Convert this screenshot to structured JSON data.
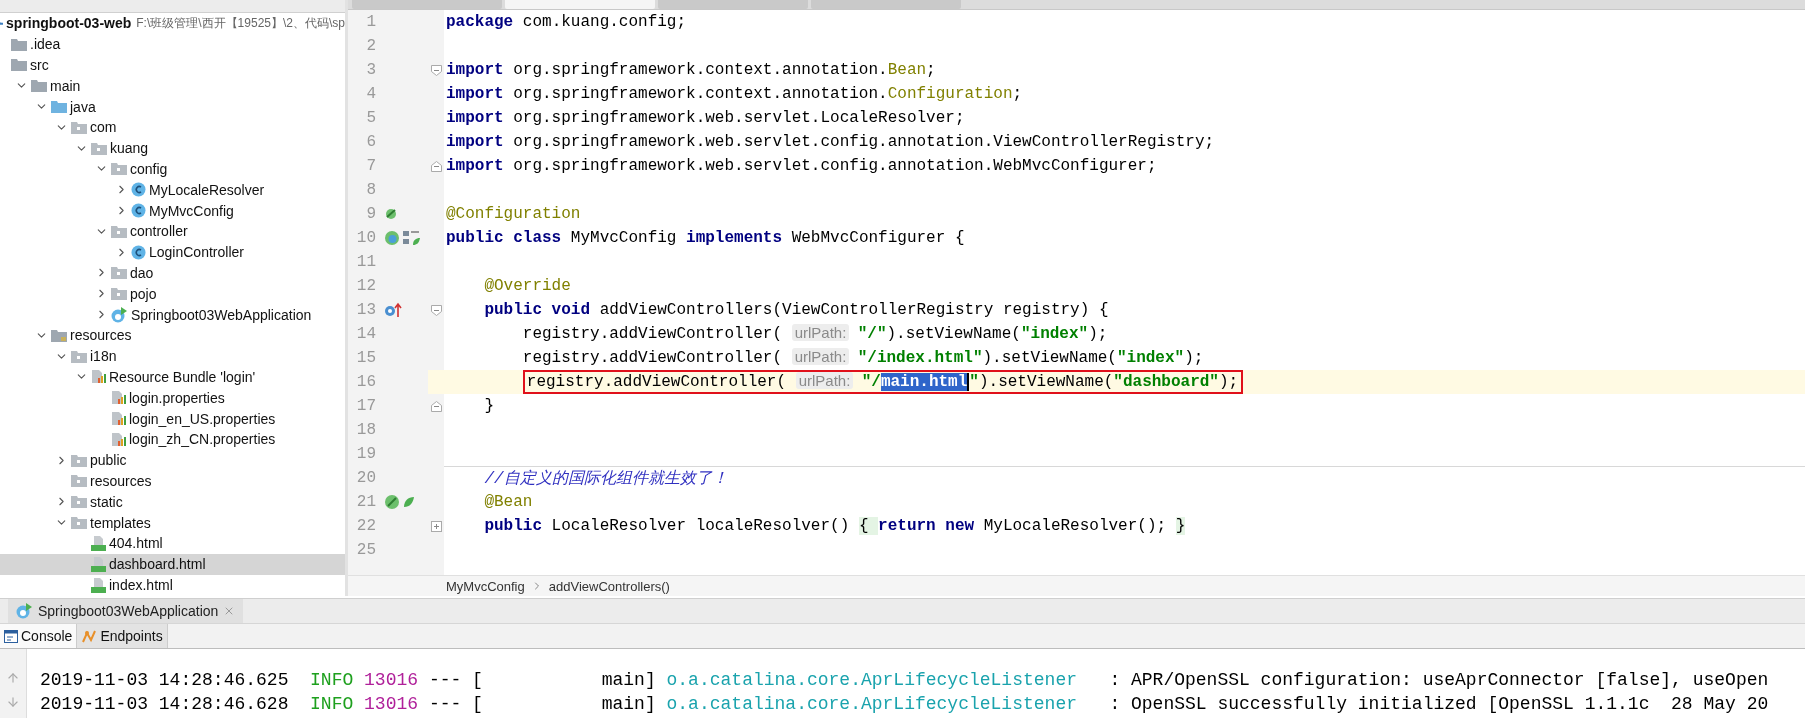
{
  "editor_tabs": [
    {
      "selected": false
    },
    {
      "selected": true
    },
    {
      "selected": false
    },
    {
      "selected": false
    }
  ],
  "project_tree": [
    {
      "label": "springboot-03-web",
      "path": "F:\\班级管理\\西开【19525】\\2、代码\\sp",
      "kind": "module",
      "selected": false,
      "children": [
        {
          "label": ".idea",
          "kind": "folder",
          "selected": false
        },
        {
          "label": "src",
          "kind": "folder",
          "selected": false,
          "children": [
            {
              "label": "main",
              "kind": "folder",
              "expanded": true,
              "selected": false,
              "children": [
                {
                  "label": "java",
                  "kind": "source",
                  "expanded": true,
                  "selected": false,
                  "children": [
                    {
                      "label": "com",
                      "kind": "package",
                      "expanded": true,
                      "selected": false,
                      "children": [
                        {
                          "label": "kuang",
                          "kind": "package",
                          "expanded": true,
                          "selected": false,
                          "children": [
                            {
                              "label": "config",
                              "kind": "package",
                              "expanded": true,
                              "selected": false,
                              "children": [
                                {
                                  "label": "MyLocaleResolver",
                                  "kind": "class",
                                  "expanded": false,
                                  "selected": false
                                },
                                {
                                  "label": "MyMvcConfig",
                                  "kind": "class",
                                  "expanded": false,
                                  "selected": false
                                }
                              ]
                            },
                            {
                              "label": "controller",
                              "kind": "package",
                              "expanded": true,
                              "selected": false,
                              "children": [
                                {
                                  "label": "LoginController",
                                  "kind": "class",
                                  "expanded": false,
                                  "selected": false
                                }
                              ]
                            },
                            {
                              "label": "dao",
                              "kind": "package",
                              "expanded": false,
                              "selected": false
                            },
                            {
                              "label": "pojo",
                              "kind": "package",
                              "expanded": false,
                              "selected": false
                            },
                            {
                              "label": "Springboot03WebApplication",
                              "kind": "app",
                              "expanded": false,
                              "selected": false
                            }
                          ]
                        }
                      ]
                    }
                  ]
                },
                {
                  "label": "resources",
                  "kind": "resources",
                  "expanded": true,
                  "selected": false,
                  "children": [
                    {
                      "label": "i18n",
                      "kind": "package",
                      "expanded": true,
                      "selected": false,
                      "children": [
                        {
                          "label": "Resource Bundle 'login'",
                          "kind": "bundle",
                          "expanded": true,
                          "selected": false,
                          "children": [
                            {
                              "label": "login.properties",
                              "kind": "properties",
                              "selected": false
                            },
                            {
                              "label": "login_en_US.properties",
                              "kind": "properties",
                              "selected": false
                            },
                            {
                              "label": "login_zh_CN.properties",
                              "kind": "properties",
                              "selected": false
                            }
                          ]
                        }
                      ]
                    },
                    {
                      "label": "public",
                      "kind": "package",
                      "expanded": false,
                      "selected": false
                    },
                    {
                      "label": "resources",
                      "kind": "package",
                      "selected": false
                    },
                    {
                      "label": "static",
                      "kind": "package",
                      "expanded": false,
                      "selected": false
                    },
                    {
                      "label": "templates",
                      "kind": "package",
                      "expanded": true,
                      "selected": false,
                      "children": [
                        {
                          "label": "404.html",
                          "kind": "html",
                          "selected": false
                        },
                        {
                          "label": "dashboard.html",
                          "kind": "html",
                          "selected": true
                        },
                        {
                          "label": "index.html",
                          "kind": "html",
                          "selected": false
                        }
                      ]
                    }
                  ]
                }
              ]
            }
          ]
        }
      ]
    }
  ],
  "code_lines": [
    {
      "number": "1",
      "current": false,
      "tokens": [
        {
          "kind": "keyword",
          "text": "package"
        },
        {
          "kind": "plain",
          "text": " com.kuang.config;"
        }
      ]
    },
    {
      "number": "2",
      "current": false
    },
    {
      "number": "3",
      "current": false,
      "fold": {
        "kind": "start"
      },
      "tokens": [
        {
          "kind": "keyword",
          "text": "import"
        },
        {
          "kind": "plain",
          "text": " org.springframework.context.annotation."
        },
        {
          "kind": "annotation",
          "text": "Bean"
        },
        {
          "kind": "plain",
          "text": ";"
        }
      ]
    },
    {
      "number": "4",
      "current": false,
      "tokens": [
        {
          "kind": "keyword",
          "text": "import"
        },
        {
          "kind": "plain",
          "text": " org.springframework.context.annotation."
        },
        {
          "kind": "annotation",
          "text": "Configuration"
        },
        {
          "kind": "plain",
          "text": ";"
        }
      ]
    },
    {
      "number": "5",
      "current": false,
      "tokens": [
        {
          "kind": "keyword",
          "text": "import"
        },
        {
          "kind": "plain",
          "text": " org.springframework.web.servlet.LocaleResolver;"
        }
      ]
    },
    {
      "number": "6",
      "current": false,
      "tokens": [
        {
          "kind": "keyword",
          "text": "import"
        },
        {
          "kind": "plain",
          "text": " org.springframework.web.servlet.config.annotation.ViewControllerRegistry;"
        }
      ]
    },
    {
      "number": "7",
      "current": false,
      "fold": {
        "kind": "end"
      },
      "tokens": [
        {
          "kind": "keyword",
          "text": "import"
        },
        {
          "kind": "plain",
          "text": " org.springframework.web.servlet.config.annotation.WebMvcConfigurer;"
        }
      ]
    },
    {
      "number": "8",
      "current": false
    },
    {
      "number": "9",
      "current": false,
      "gutter": {
        "kind": "bean"
      },
      "tokens": [
        {
          "kind": "annotation",
          "text": "@Configuration"
        }
      ]
    },
    {
      "number": "10",
      "current": false,
      "gutter": {
        "kind": "class"
      },
      "tokens": [
        {
          "kind": "keyword",
          "text": "public class"
        },
        {
          "kind": "plain",
          "text": " MyMvcConfig "
        },
        {
          "kind": "keyword",
          "text": "implements"
        },
        {
          "kind": "plain",
          "text": " WebMvcConfigurer {"
        }
      ]
    },
    {
      "number": "11",
      "current": false
    },
    {
      "number": "12",
      "current": false,
      "indent": {
        "kind": "member"
      },
      "tokens": [
        {
          "kind": "annotation",
          "text": "@Override"
        }
      ]
    },
    {
      "number": "13",
      "current": false,
      "indent": {
        "kind": "member"
      },
      "gutter": {
        "kind": "override"
      },
      "fold": {
        "kind": "start"
      },
      "tokens": [
        {
          "kind": "keyword",
          "text": "public void"
        },
        {
          "kind": "plain",
          "text": " addViewControllers(ViewControllerRegistry registry) {"
        }
      ]
    },
    {
      "number": "14",
      "current": false,
      "indent": {
        "kind": "body"
      },
      "tokens": [
        {
          "kind": "plain",
          "text": "registry.addViewController( "
        },
        {
          "kind": "hint",
          "text": "urlPath:"
        },
        {
          "kind": "string",
          "text": "\"/\""
        },
        {
          "kind": "plain",
          "text": ").setViewName("
        },
        {
          "kind": "string",
          "text": "\"index\""
        },
        {
          "kind": "plain",
          "text": ");"
        }
      ]
    },
    {
      "number": "15",
      "current": false,
      "indent": {
        "kind": "body"
      },
      "tokens": [
        {
          "kind": "plain",
          "text": "registry.addViewController( "
        },
        {
          "kind": "hint",
          "text": "urlPath:"
        },
        {
          "kind": "string",
          "text": "\"/index.html\""
        },
        {
          "kind": "plain",
          "text": ").setViewName("
        },
        {
          "kind": "string",
          "text": "\"index\""
        },
        {
          "kind": "plain",
          "text": ");"
        }
      ]
    },
    {
      "number": "16",
      "current": true,
      "boxed": true,
      "indent": {
        "kind": "body"
      },
      "tokens": [
        {
          "kind": "plain",
          "text": "registry.addViewController( "
        },
        {
          "kind": "hint",
          "text": "urlPath:"
        },
        {
          "kind": "string",
          "text": "\"/"
        },
        {
          "kind": "selection",
          "text": "main.html"
        },
        {
          "kind": "string",
          "text": "\""
        },
        {
          "kind": "plain",
          "text": ").setViewName("
        },
        {
          "kind": "string",
          "text": "\"dashboard\""
        },
        {
          "kind": "plain",
          "text": ");"
        }
      ]
    },
    {
      "number": "17",
      "current": false,
      "indent": {
        "kind": "member"
      },
      "fold": {
        "kind": "end"
      },
      "tokens": [
        {
          "kind": "plain",
          "text": "}"
        }
      ]
    },
    {
      "number": "18",
      "current": false
    },
    {
      "number": "19",
      "current": false
    },
    {
      "number": "20",
      "current": false,
      "separator": true,
      "indent": {
        "kind": "member"
      },
      "tokens": [
        {
          "kind": "comment",
          "text": "//自定义的国际化组件就生效了！"
        }
      ]
    },
    {
      "number": "21",
      "current": false,
      "indent": {
        "kind": "member"
      },
      "gutter": {
        "kind": "bean-method"
      },
      "tokens": [
        {
          "kind": "annotation",
          "text": "@Bean"
        }
      ]
    },
    {
      "number": "22",
      "current": false,
      "indent": {
        "kind": "member"
      },
      "fold": {
        "kind": "collapsed"
      },
      "tokens": [
        {
          "kind": "keyword",
          "text": "public"
        },
        {
          "kind": "plain",
          "text": " LocaleResolver localeResolver() "
        },
        {
          "kind": "folded",
          "text": "{ "
        },
        {
          "kind": "keyword",
          "text": "return new"
        },
        {
          "kind": "plain",
          "text": " MyLocaleResolver(); "
        },
        {
          "kind": "folded",
          "text": "}"
        }
      ]
    },
    {
      "number": "25",
      "current": false
    }
  ],
  "breadcrumb": [
    "MyMvcConfig",
    "addViewControllers()"
  ],
  "run_tab": {
    "label": "Springboot03WebApplication"
  },
  "tool_tabs": [
    {
      "label": "Console",
      "kind": "console",
      "selected": true
    },
    {
      "label": "Endpoints",
      "kind": "endpoints",
      "selected": false
    }
  ],
  "console_lines": [
    {
      "time": "2019-11-03 14:28:46.625",
      "level": "INFO",
      "pid": "13016",
      "sep": "---",
      "thread": "[           main]",
      "logger": "o.a.catalina.core.AprLifecycleListener",
      "message": ": APR/OpenSSL configuration: useAprConnector [false], useOpen"
    },
    {
      "time": "2019-11-03 14:28:46.628",
      "level": "INFO",
      "pid": "13016",
      "sep": "---",
      "thread": "[           main]",
      "logger": "o.a.catalina.core.AprLifecycleListener",
      "message": ": OpenSSL successfully initialized [OpenSSL 1.1.1c  28 May 20"
    }
  ]
}
